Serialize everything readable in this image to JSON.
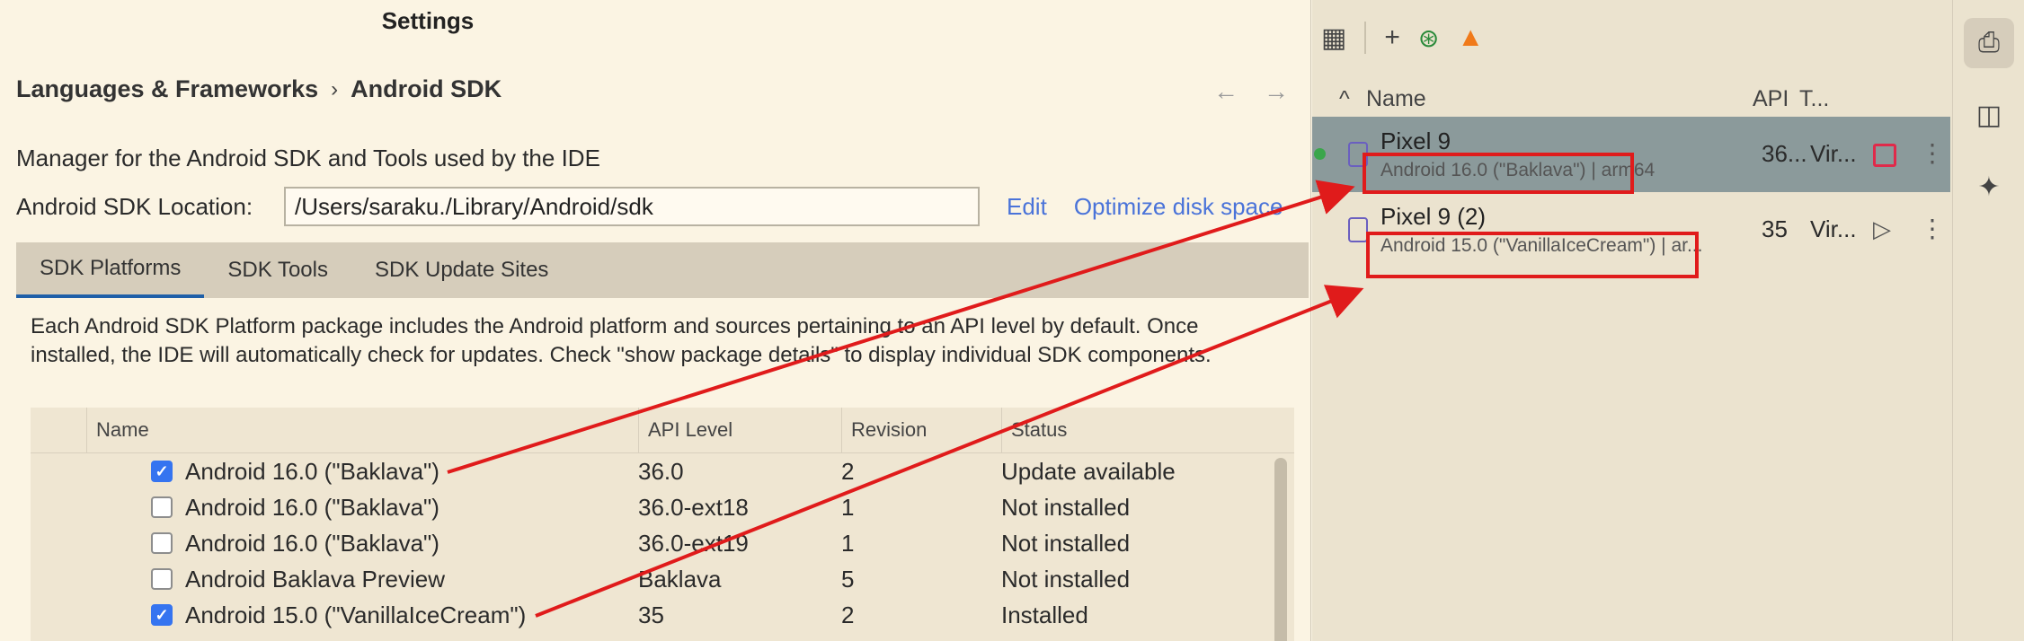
{
  "settings": {
    "title": "Settings",
    "breadcrumb": [
      "Languages & Frameworks",
      "Android SDK"
    ],
    "breadcrumb_sep": "›",
    "nav_back": "←",
    "nav_forward": "→",
    "description": "Manager for the Android SDK and Tools used by the IDE",
    "location_label": "Android SDK Location:",
    "location_value": "/Users/saraku./Library/Android/sdk",
    "edit_link": "Edit",
    "optimize_link": "Optimize disk space",
    "tabs": [
      "SDK Platforms",
      "SDK Tools",
      "SDK Update Sites"
    ],
    "active_tab": "SDK Platforms",
    "platform_description": "Each Android SDK Platform package includes the Android platform and sources pertaining to an API level by default. Once installed, the IDE will automatically check for updates. Check \"show package details\" to display individual SDK components.",
    "table": {
      "headers": [
        "Name",
        "API Level",
        "Revision",
        "Status"
      ],
      "rows": [
        {
          "name": "Android 16.0 (\"Baklava\")",
          "api": "36.0",
          "rev": "2",
          "status": "Update available",
          "checked": true
        },
        {
          "name": "Android 16.0 (\"Baklava\")",
          "api": "36.0-ext18",
          "rev": "1",
          "status": "Not installed",
          "checked": false
        },
        {
          "name": "Android 16.0 (\"Baklava\")",
          "api": "36.0-ext19",
          "rev": "1",
          "status": "Not installed",
          "checked": false
        },
        {
          "name": "Android Baklava Preview",
          "api": "Baklava",
          "rev": "5",
          "status": "Not installed",
          "checked": false
        },
        {
          "name": "Android 15.0 (\"VanillaIceCream\")",
          "api": "35",
          "rev": "2",
          "status": "Installed",
          "checked": true
        }
      ]
    }
  },
  "devices": {
    "toolbar": [
      "grid-icon",
      "plus-icon",
      "wifi-add-icon",
      "flame-icon"
    ],
    "headers": {
      "sort": "^",
      "name": "Name",
      "api": "API",
      "type": "T..."
    },
    "rows": [
      {
        "name": "Pixel 9",
        "sub": "Android 16.0 (\"Baklava\") | arm64",
        "api": "36...",
        "type": "Vir...",
        "running": true,
        "selected": true
      },
      {
        "name": "Pixel 9 (2)",
        "sub": "Android 15.0 (\"VanillaIceCream\") | ar...",
        "api": "35",
        "type": "Vir...",
        "running": false,
        "selected": false
      }
    ]
  },
  "colors": {
    "annotation": "#e01b1b",
    "accent": "#3574f0",
    "link": "#4a73d9",
    "selected_row": "#8b9a9b"
  }
}
